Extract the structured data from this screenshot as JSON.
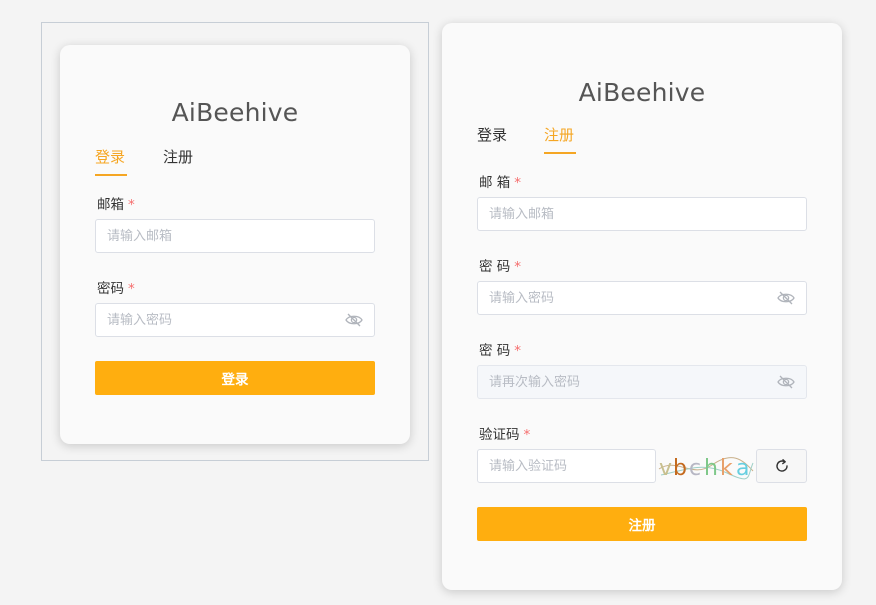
{
  "login": {
    "brand": "AiBeehive",
    "tabs": [
      {
        "label": "登录",
        "active": true
      },
      {
        "label": "注册",
        "active": false
      }
    ],
    "email_label": "邮箱",
    "email_placeholder": "请输入邮箱",
    "password_label": "密码",
    "password_placeholder": "请输入密码",
    "required_mark": "*",
    "submit_label": "登录"
  },
  "register": {
    "brand": "AiBeehive",
    "tabs": [
      {
        "label": "登录",
        "active": false
      },
      {
        "label": "注册",
        "active": true
      }
    ],
    "email_label": "邮 箱",
    "email_placeholder": "请输入邮箱",
    "password_label": "密 码",
    "password_placeholder": "请输入密码",
    "confirm_label": "密 码",
    "confirm_placeholder": "请再次输入密码",
    "captcha_label": "验证码",
    "captcha_placeholder": "请输入验证码",
    "captcha_text": "vbchka",
    "required_mark": "*",
    "submit_label": "注册"
  },
  "colors": {
    "accent": "#f5a623",
    "button": "#ffae0f",
    "required": "#f56c6c",
    "background": "#f4f4f4",
    "card": "#fafafa"
  },
  "icons": {
    "password_toggle": "eye-off-icon",
    "refresh": "refresh-icon"
  }
}
